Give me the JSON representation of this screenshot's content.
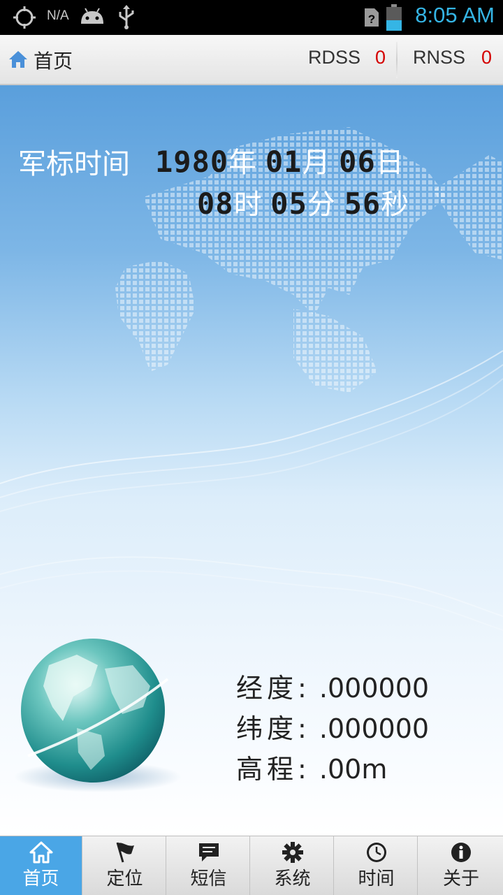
{
  "status_bar": {
    "carrier_text": "N/A",
    "time": "8:05 AM",
    "icons": [
      "gps-icon",
      "android-icon",
      "usb-icon",
      "sim-icon",
      "battery-icon"
    ]
  },
  "action_bar": {
    "title": "首页",
    "rdss_label": "RDSS",
    "rdss_count": "0",
    "rnss_label": "RNSS",
    "rnss_count": "0"
  },
  "time_panel": {
    "label": "军标时间",
    "year": "1980",
    "year_unit": "年",
    "month": "01",
    "month_unit": "月",
    "day": "06",
    "day_unit": "日",
    "hour": "08",
    "hour_unit": "时",
    "minute": "05",
    "minute_unit": "分",
    "second": "56",
    "second_unit": "秒"
  },
  "position_panel": {
    "longitude_label": "经度:",
    "longitude_value": ".000000",
    "latitude_label": "纬度:",
    "latitude_value": ".000000",
    "altitude_label": "高程:",
    "altitude_value": ".00m"
  },
  "tabs": [
    {
      "label": "首页",
      "icon": "home-icon",
      "active": true
    },
    {
      "label": "定位",
      "icon": "flag-icon",
      "active": false
    },
    {
      "label": "短信",
      "icon": "message-icon",
      "active": false
    },
    {
      "label": "系统",
      "icon": "gear-icon",
      "active": false
    },
    {
      "label": "时间",
      "icon": "clock-icon",
      "active": false
    },
    {
      "label": "关于",
      "icon": "info-icon",
      "active": false
    }
  ],
  "colors": {
    "accent": "#35b5e5",
    "tab_active": "#4aa6e6",
    "count_red": "#d40000"
  }
}
